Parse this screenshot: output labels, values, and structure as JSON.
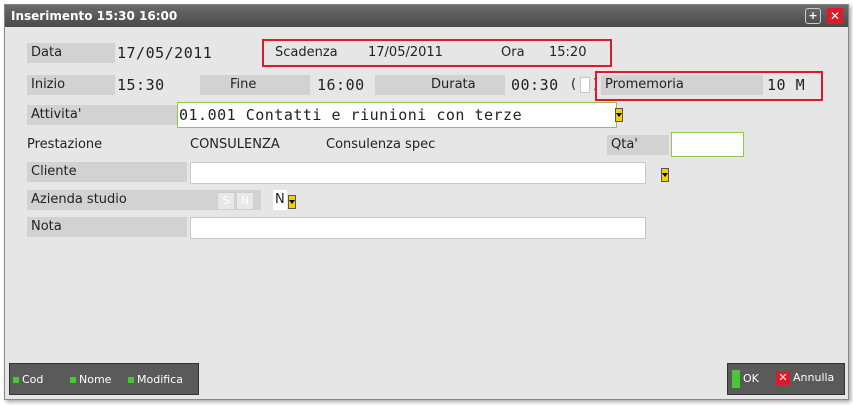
{
  "window": {
    "title": "Inserimento 15:30 16:00",
    "maximize_icon": "maximize-icon",
    "close_icon": "close-icon"
  },
  "form": {
    "data_label": "Data",
    "data_value": "17/05/2011",
    "scadenza_label": "Scadenza",
    "scadenza_value": "17/05/2011",
    "ora_label": "Ora",
    "ora_value": "15:20",
    "inizio_label": "Inizio",
    "inizio_value": "15:30",
    "fine_label": "Fine",
    "fine_value": "16:00",
    "durata_label": "Durata",
    "durata_value": "00:30",
    "durata_paren_open": "(",
    "durata_paren_close": ")",
    "promemoria_label": "Promemoria",
    "promemoria_value": "10 M",
    "attivita_label": "Attivita'",
    "attivita_value": "01.001 Contatti e riunioni con terze",
    "prestazione_label": "Prestazione",
    "prestazione_code": "CONSULENZA",
    "prestazione_desc": "Consulenza spec",
    "qta_label": "Qta'",
    "qta_value": "",
    "cliente_label": "Cliente",
    "cliente_value": "",
    "azienda_label": "Azienda studio",
    "azienda_s": "S",
    "azienda_n": "N",
    "azienda_value": "N",
    "nota_label": "Nota",
    "nota_value": ""
  },
  "buttons": {
    "cod": "Cod",
    "nome": "Nome",
    "modifica": "Modifica",
    "ok": "OK",
    "annulla": "Annulla"
  },
  "colors": {
    "titlebar": "#4a4a4a",
    "highlight_box": "#e0192a",
    "attivita_border": "#8cc84b",
    "dropdown": "#f5d000",
    "button_green": "#45c832",
    "close_red": "#e0192a"
  }
}
